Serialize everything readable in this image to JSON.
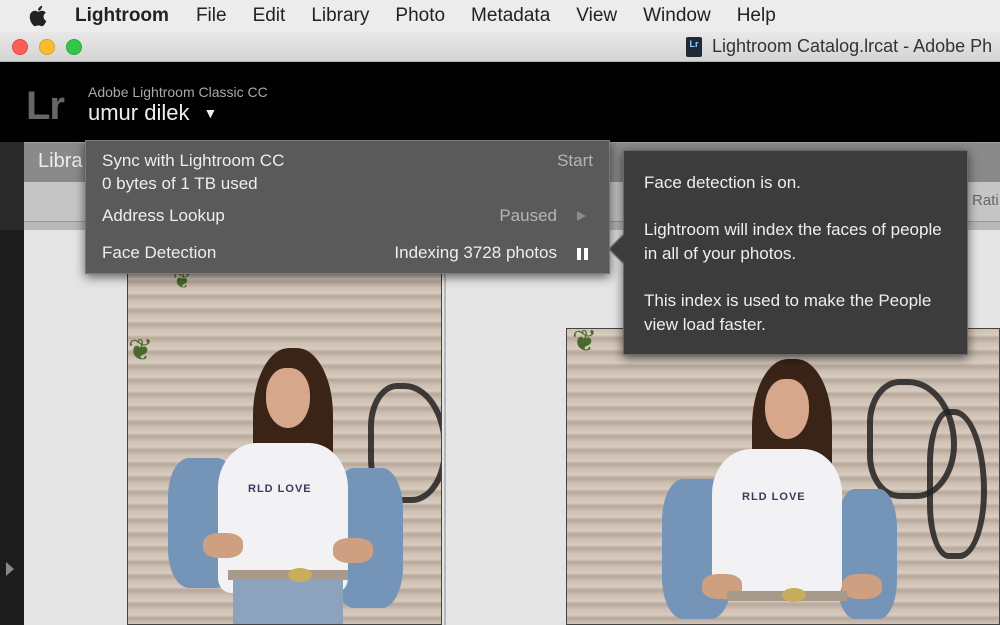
{
  "menubar": {
    "app": "Lightroom",
    "items": [
      "File",
      "Edit",
      "Library",
      "Photo",
      "Metadata",
      "View",
      "Window",
      "Help"
    ]
  },
  "window": {
    "title": "Lightroom Catalog.lrcat - Adobe Ph",
    "doc_icon": "Lr"
  },
  "identity": {
    "logo": "Lr",
    "product": "Adobe Lightroom Classic CC",
    "user": "umur dilek",
    "menu_triangle": "▼"
  },
  "module": {
    "tab_label": "Libra",
    "toolbar_left": "ute",
    "toolbar_right": "Rati"
  },
  "sync_panel": {
    "sync_title": "Sync with Lightroom CC",
    "sync_action": "Start",
    "storage": "0 bytes of 1 TB used",
    "address_label": "Address Lookup",
    "address_status": "Paused",
    "face_label": "Face Detection",
    "face_status": "Indexing 3728 photos"
  },
  "tooltip": {
    "line1": "Face detection is on.",
    "line2": "Lightroom will index the faces of people in all of your photos.",
    "line3": "This index is used to make the People view load faster."
  },
  "photos": {
    "shirt_text": "RLD LOVE"
  },
  "colors": {
    "menubar_bg": "#ececec",
    "popup_bg": "#5a5a5a",
    "tooltip_bg": "#3c3c3c",
    "traffic_red": "#fc5f57",
    "traffic_yellow": "#fdbc2e",
    "traffic_green": "#33c748"
  },
  "icons": [
    "apple-icon",
    "play-icon",
    "pause-icon",
    "dropdown-triangle-icon",
    "panel-expand-icon"
  ]
}
